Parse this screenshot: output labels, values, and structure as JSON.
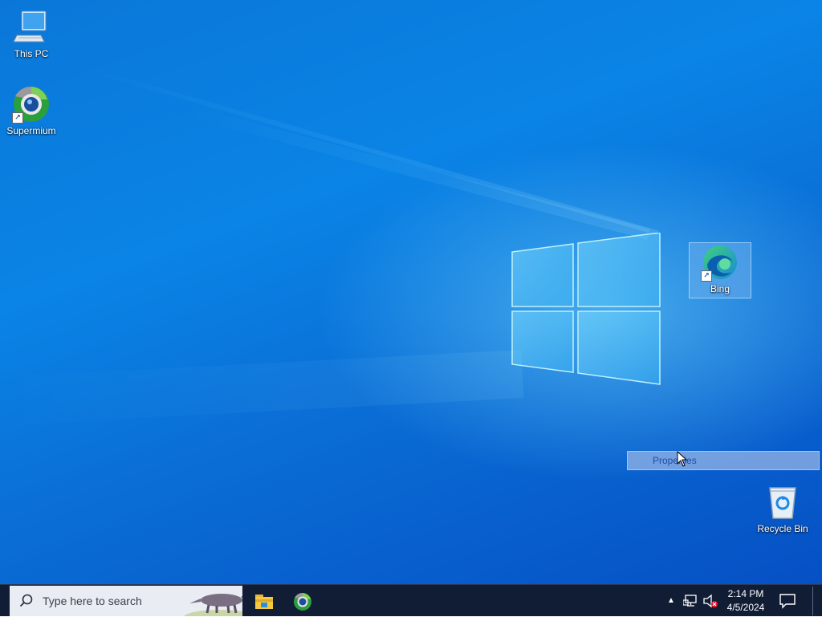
{
  "desktop": {
    "icons": [
      {
        "label": "This PC",
        "icon": "computer-icon"
      },
      {
        "label": "Supermium",
        "icon": "supermium-browser-icon"
      },
      {
        "label": "Bing",
        "icon": "edge-bing-icon",
        "selected": true
      },
      {
        "label": "Recycle Bin",
        "icon": "recycle-bin-icon"
      }
    ],
    "context_menu": {
      "items": [
        {
          "label": "Properties",
          "highlighted": true
        }
      ]
    }
  },
  "taskbar": {
    "search_placeholder": "Type here to search",
    "pinned_apps": [
      {
        "name": "File Explorer",
        "icon": "file-explorer-icon"
      },
      {
        "name": "Supermium",
        "icon": "supermium-browser-icon"
      }
    ],
    "tray": {
      "icons": [
        "chevron-up-icon",
        "network-icon",
        "volume-muted-icon"
      ],
      "time": "2:14 PM",
      "date": "4/5/2024"
    }
  },
  "colors": {
    "desktop_blue": "#0a77d8",
    "taskbar_bg": "#101d35",
    "selection": "#78b4f0"
  }
}
